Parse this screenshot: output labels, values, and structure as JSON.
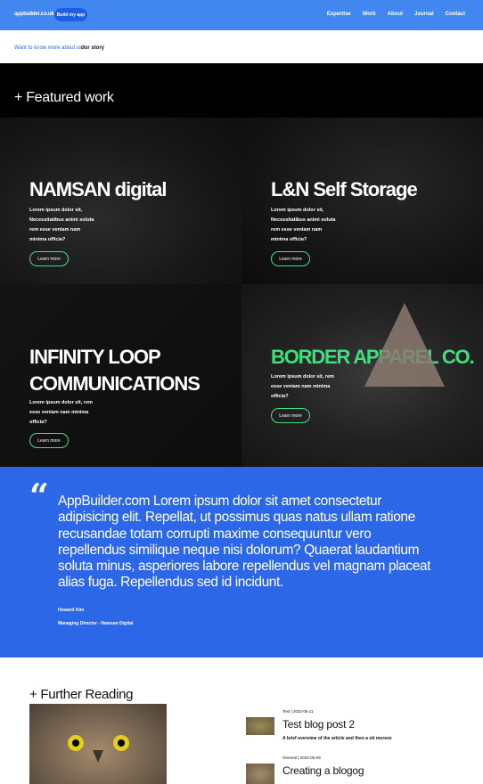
{
  "header": {
    "logo": "appbuilder.co.uk",
    "cta_label": "Build my app",
    "nav": [
      "Expertise",
      "Work",
      "About",
      "Journal",
      "Contact"
    ]
  },
  "breadcrumb": {
    "link": "Want to know more about us?",
    "current": "our story"
  },
  "featured": {
    "title": "+ Featured work",
    "items": [
      {
        "title": "NAMSAN digital",
        "text_lines": [
          "Lorem ipsum dolor sit,",
          "Necessitatibus animi soluta",
          "rem esse veniam nam",
          "minima officia?"
        ],
        "button": "Learn more"
      },
      {
        "title": "L&N Self Storage",
        "text_lines": [
          "Lorem ipsum dolor sit,",
          "Necessitatibus animi soluta",
          "rem esse veniam nam",
          "minima officia?"
        ],
        "button": "Learn more"
      },
      {
        "title_lines": [
          "INFINITY LOOP",
          "COMMUNICATIONS"
        ],
        "text_lines": [
          "Lorem ipsum dolor sit, rem",
          "esse veniam nam minima",
          "officia?"
        ],
        "button": "Learn more"
      },
      {
        "title": "BORDER APPAREL CO.",
        "text_lines": [
          "Lorem ipsum dolor sit, rem",
          "esse veniam nam minima",
          "officia?"
        ],
        "button": "Learn more",
        "accent": "#3ee07d"
      }
    ]
  },
  "testimonial": {
    "quote": "AppBuilder.com Lorem ipsum dolor sit amet consectetur adipisicing elit. Repellat, ut possimus quas natus ullam ratione recusandae totam corrupti maxime consequuntur vero repellendus similique neque nisi dolorum? Quaerat laudantium soluta minus, asperiores labore repellendus vel magnam placeat alias fuga. Repellendus sed id incidunt.",
    "name": "Howard Kim",
    "role": "Managing Director - Namsan Digital"
  },
  "reading": {
    "title": "+ Further Reading",
    "posts": [
      {
        "meta": "Test | 2022-05-11",
        "title": "Test blog post 2",
        "desc": "A brief overview of the article and then a nit moreee"
      },
      {
        "meta": "General | 2022-05-09",
        "title": "Creating a blogog"
      }
    ]
  },
  "colors": {
    "header": "#4287f0",
    "accent_green": "#3ee07d",
    "quote_bg": "#2c67e8"
  },
  "icons": [
    "quote-icon"
  ]
}
